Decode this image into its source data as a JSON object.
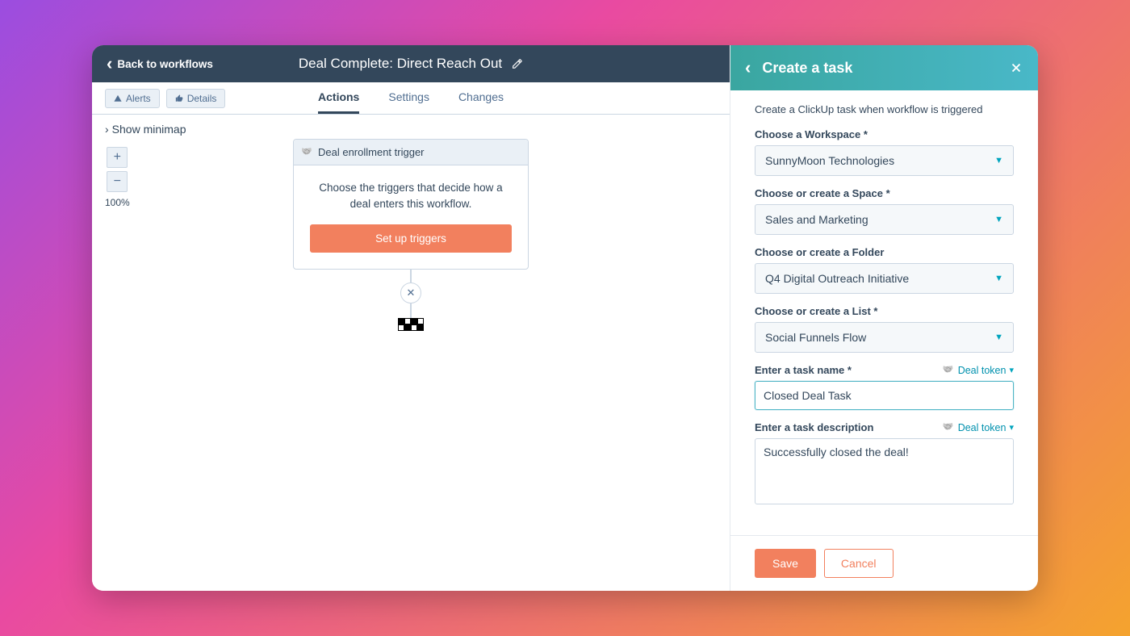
{
  "topbar": {
    "back": "Back to workflows",
    "title": "Deal Complete: Direct Reach Out"
  },
  "toolbar": {
    "alerts": "Alerts",
    "details": "Details"
  },
  "tabs": [
    "Actions",
    "Settings",
    "Changes"
  ],
  "activeTab": 0,
  "canvas": {
    "minimap": "Show minimap",
    "zoom": "100%",
    "triggerHead": "Deal enrollment trigger",
    "triggerText": "Choose the triggers that decide how a deal enters this workflow.",
    "triggerButton": "Set up triggers"
  },
  "panel": {
    "title": "Create a task",
    "desc": "Create a ClickUp task when workflow is triggered",
    "tokenLabel": "Deal token",
    "fields": {
      "workspace": {
        "label": "Choose a Workspace *",
        "value": "SunnyMoon Technologies"
      },
      "space": {
        "label": "Choose or create a Space *",
        "value": "Sales and Marketing"
      },
      "folder": {
        "label": "Choose or create a Folder",
        "value": "Q4 Digital Outreach Initiative"
      },
      "list": {
        "label": "Choose or create a List *",
        "value": "Social Funnels Flow"
      },
      "taskName": {
        "label": "Enter a task name *",
        "value": "Closed Deal Task"
      },
      "taskDesc": {
        "label": "Enter a task description",
        "value": "Successfully closed the deal!"
      }
    },
    "save": "Save",
    "cancel": "Cancel"
  }
}
